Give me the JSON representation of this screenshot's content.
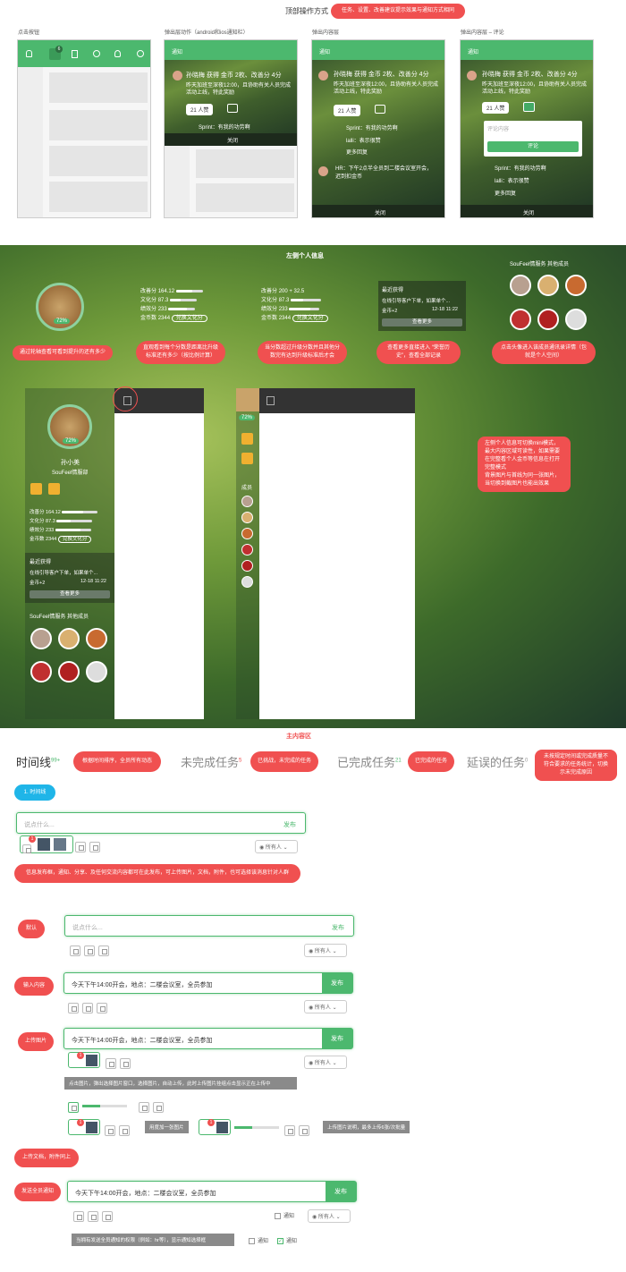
{
  "header": {
    "title": "顶部操作方式",
    "badge": "任务、设置、改善建议提示效果与通知方式相同"
  },
  "top_mockups": {
    "labels": [
      "点击按钮",
      "弹出层动作（android和ios通知栏）",
      "弹出内容层",
      "弹出内容层 – 评论"
    ],
    "notice_title": "通知",
    "post_title": "孙晓梅 获得 金币 2枚、改善分 4分",
    "post_body": "昨天加班至深夜12:00，且协助有关人员完成活动上线，特此奖励",
    "like_label": "21 人赞",
    "comment1": "Sprint：有我的功劳啊",
    "comment2": "lalli：表示很赞",
    "more_replies": "更多回复",
    "post2": "HR：下午2点半全员到二楼会议室开会，迟到扣金币",
    "close": "关闭",
    "comment_placeholder": "评论内容",
    "comment_button": "评论",
    "badge_num": "6"
  },
  "left_panel": {
    "section_title": "左侧个人信息",
    "progress": "72%",
    "stats": [
      {
        "label": "改善分",
        "value": "164.12",
        "fill": 0.6
      },
      {
        "label": "文化分",
        "value": "87.3",
        "fill": 0.4
      },
      {
        "label": "绩效分",
        "value": "233",
        "fill": 0.7
      },
      {
        "label": "金币数",
        "value": "2344"
      }
    ],
    "stats2": [
      {
        "label": "改善分",
        "value": "200 + 32.5",
        "fill": 0.6
      },
      {
        "label": "文化分",
        "value": "87.3",
        "fill": 0.4
      },
      {
        "label": "绩效分",
        "value": "233",
        "fill": 0.7
      },
      {
        "label": "金币数",
        "value": "2344"
      }
    ],
    "exchange": "兑换文化分",
    "recent_title": "最近获得",
    "recent_item": "在线引导客户下单，如果单个...",
    "recent_coins": "金币+2",
    "recent_time": "12-18 11:22",
    "view_more": "查看更多",
    "team_title": "SouFeel情服务 其他成员",
    "username": "孙小美",
    "dept": "SouFeel情服部",
    "members_label": "成员",
    "notes": [
      "通过轮轴查看可看到提升的还有多少",
      "直观看到每个分数是距离比升级标准还有多少（按比例计算）",
      "当分数超过升级分数并且其他分数完有达到升级标准后才会",
      "查看更多直接进入 “荣誉历史”，查看全部记录",
      "点击头像进入该成员通讯录详情（包就是个人空间）"
    ],
    "mini_note": "左侧个人信息可切换mini模式，最大内容区域可读性，如果需要在完整看个人金币等信息在打开完整模式\n背景图片与首线为同一张图片，当切换到截图片也能出效果"
  },
  "main": {
    "section_title": "主内容区",
    "tabs": [
      {
        "label": "时间线",
        "count": "99+"
      },
      {
        "label": "未完成任务",
        "count": "5"
      },
      {
        "label": "已完成任务",
        "count": "21"
      },
      {
        "label": "延误的任务",
        "count": "0"
      }
    ],
    "tab_notes": [
      "根据时间排序，全员所有动态",
      "已挑战，未完成的任务",
      "已完成的任务",
      "未按规定时间或完成质量不符合要求的任务统计，切换示未完成原因"
    ],
    "step_badge": "1. 时间线",
    "composer_placeholder": "说点什么...",
    "publish": "发布",
    "visibility": "所有人",
    "composer_note": "信息发布框，通知、分享、及任何交流内容都可在此发布，可上传图片，文档，附件，也可选择该消息针对人群",
    "states": [
      "默认",
      "输入内容",
      "上传图片",
      "上传文档，附件同上",
      "发送全员通知"
    ],
    "typed_text": "今天下午14:00开会，地点：二楼会议室，全员参加",
    "upload_note": "点击图片，弹出选择图片窗口，选择图片，自动上传，此时上传图片挂组点击显示正在上传中",
    "upload_hint": "用度加一张图片",
    "upload_limit": "上传图片说明，最多上传6张/次批量",
    "notify_label": "通知",
    "notify_note": "当拥有发送全员通知的权限（例如：hr等），显示通知选择框",
    "upload_count": "1"
  },
  "colors": {
    "accent": "#4cb86e",
    "red": "#f05050",
    "blue": "#1fb5e8"
  }
}
